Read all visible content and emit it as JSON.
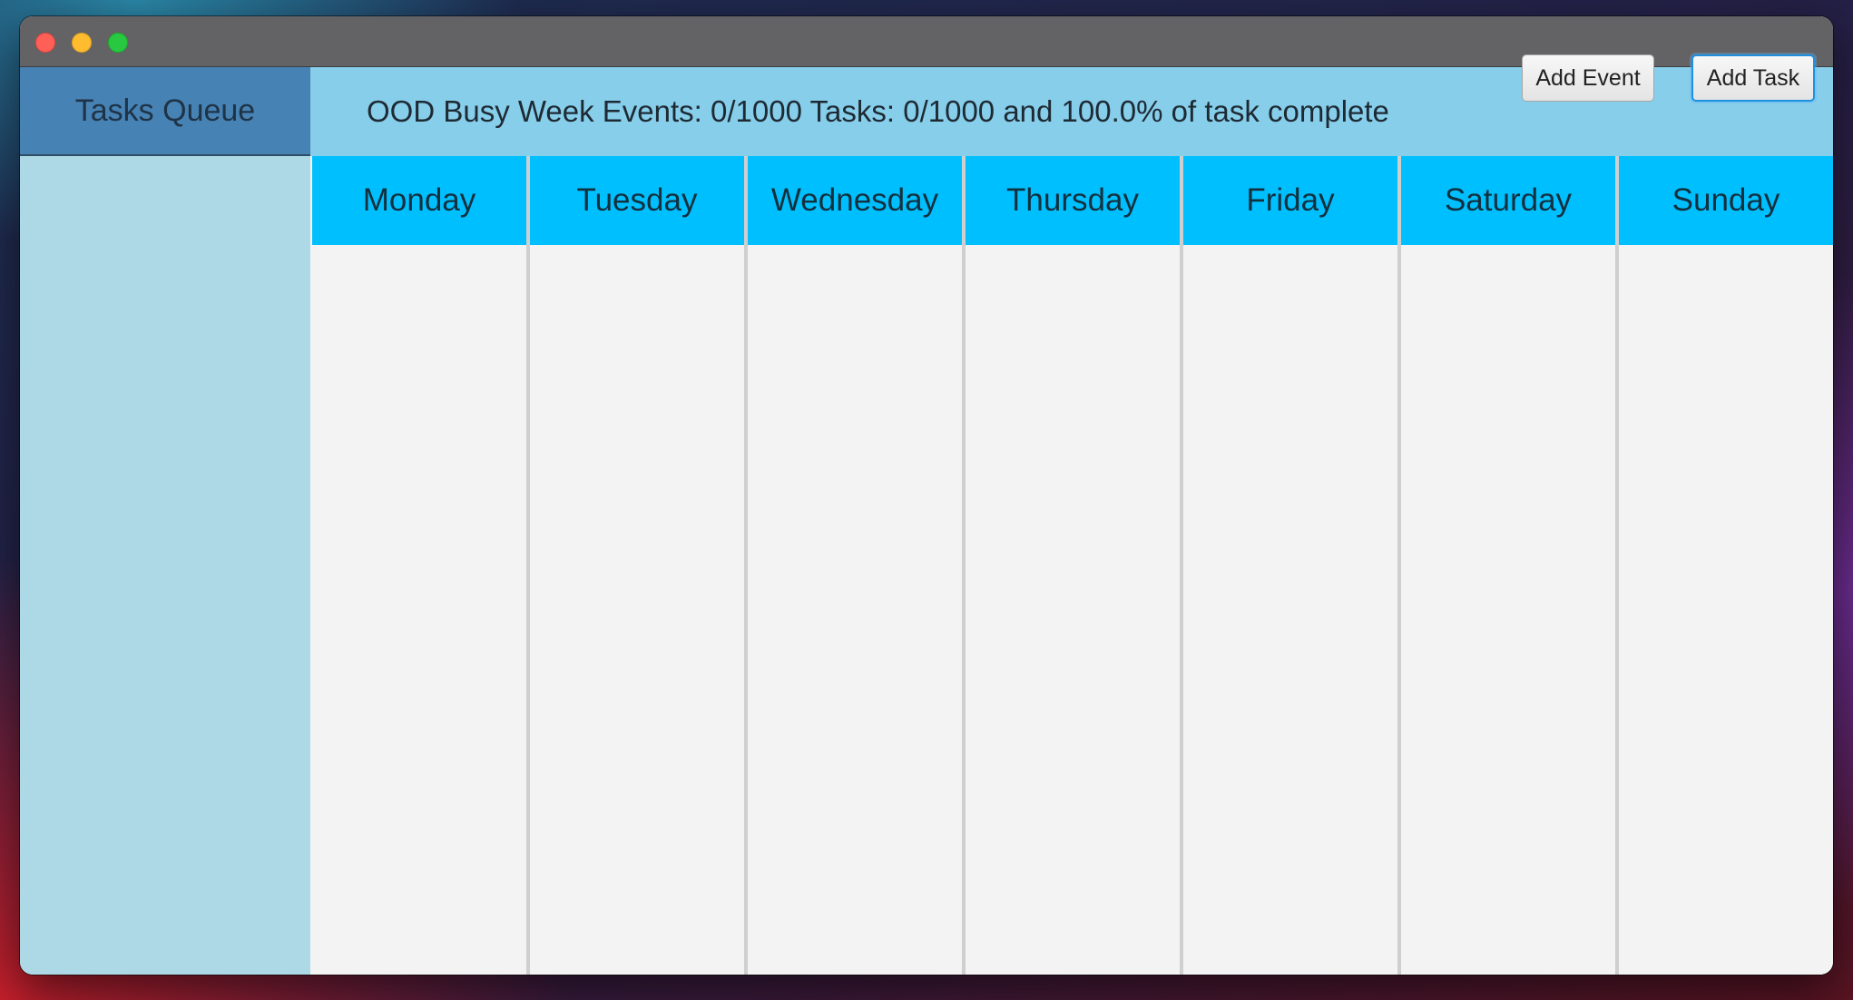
{
  "window": {
    "controls": [
      "close",
      "minimize",
      "zoom"
    ]
  },
  "sidebar": {
    "title": "Tasks Queue",
    "items": []
  },
  "header": {
    "summary": "OOD Busy Week Events: 0/1000 Tasks: 0/1000 and 100.0% of task complete",
    "add_event_label": "Add Event",
    "add_task_label": "Add Task"
  },
  "week": {
    "days": [
      {
        "label": "Monday",
        "items": []
      },
      {
        "label": "Tuesday",
        "items": []
      },
      {
        "label": "Wednesday",
        "items": []
      },
      {
        "label": "Thursday",
        "items": []
      },
      {
        "label": "Friday",
        "items": []
      },
      {
        "label": "Saturday",
        "items": []
      },
      {
        "label": "Sunday",
        "items": []
      }
    ]
  },
  "colors": {
    "sidebar_bg": "#add8e6",
    "sidebar_header_bg": "#4682b4",
    "topbar_bg": "#87ceeb",
    "day_header_bg": "#00bfff",
    "day_body_bg": "#f3f3f3"
  }
}
